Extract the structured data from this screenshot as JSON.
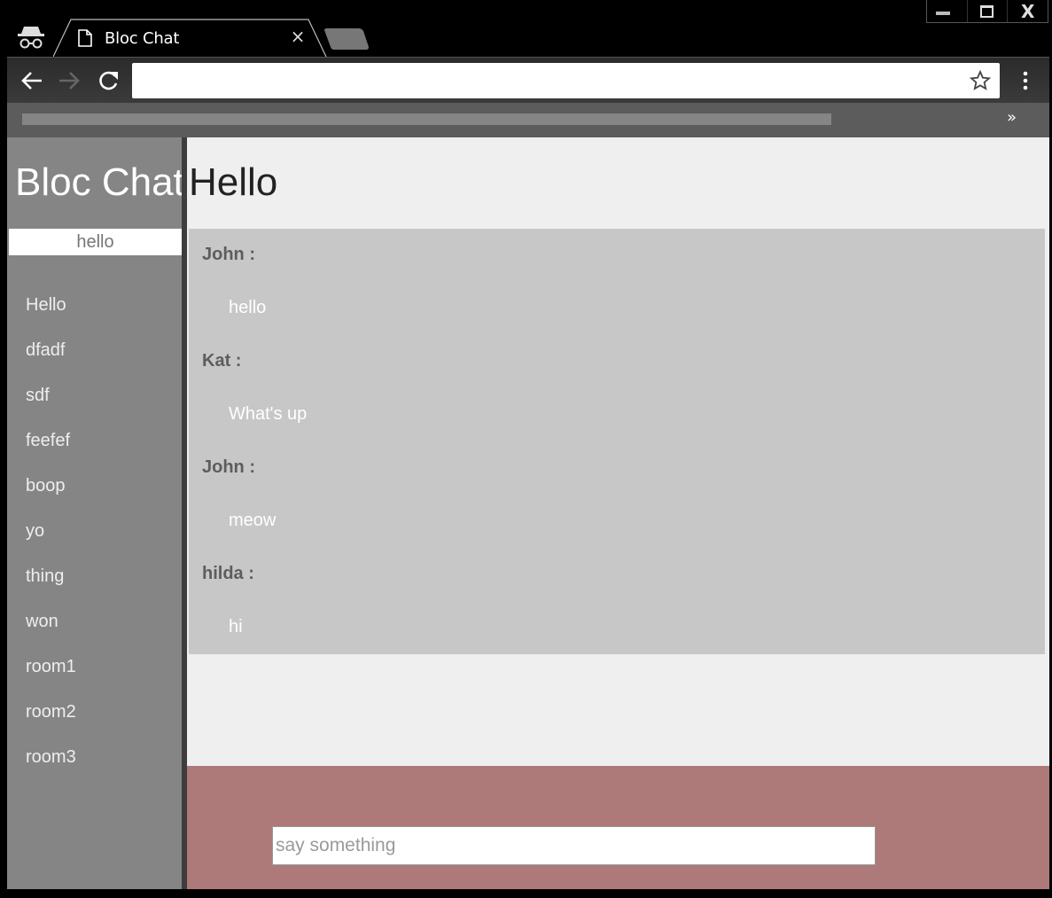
{
  "browser": {
    "tab_title": "Bloc Chat",
    "tab_close": "×",
    "omnibox_value": "",
    "bookmarks_overflow": "»",
    "window_close": "X"
  },
  "sidebar": {
    "app_title": "Bloc Chat",
    "new_room_value": "hello",
    "rooms": [
      {
        "label": "Hello"
      },
      {
        "label": "dfadf"
      },
      {
        "label": "sdf"
      },
      {
        "label": "feefef"
      },
      {
        "label": "boop"
      },
      {
        "label": "yo"
      },
      {
        "label": "thing"
      },
      {
        "label": "won"
      },
      {
        "label": "room1"
      },
      {
        "label": "room2"
      },
      {
        "label": "room3"
      }
    ]
  },
  "main": {
    "room_title": "Hello",
    "messages": [
      {
        "user": "John :",
        "text": "hello"
      },
      {
        "user": "Kat :",
        "text": "What's up"
      },
      {
        "user": "John :",
        "text": "meow"
      },
      {
        "user": "hilda :",
        "text": "hi"
      }
    ],
    "composer_placeholder": "say something"
  },
  "colors": {
    "sidebar_bg": "#858585",
    "messages_bg": "#c7c7c7",
    "composer_bg": "#ad7979",
    "page_bg": "#efefef"
  },
  "icons": {
    "incognito": "incognito-icon",
    "back": "back-arrow-icon",
    "forward": "forward-arrow-icon",
    "reload": "reload-icon",
    "bookmark": "star-icon",
    "menu": "kebab-menu-icon",
    "page": "page-icon"
  }
}
